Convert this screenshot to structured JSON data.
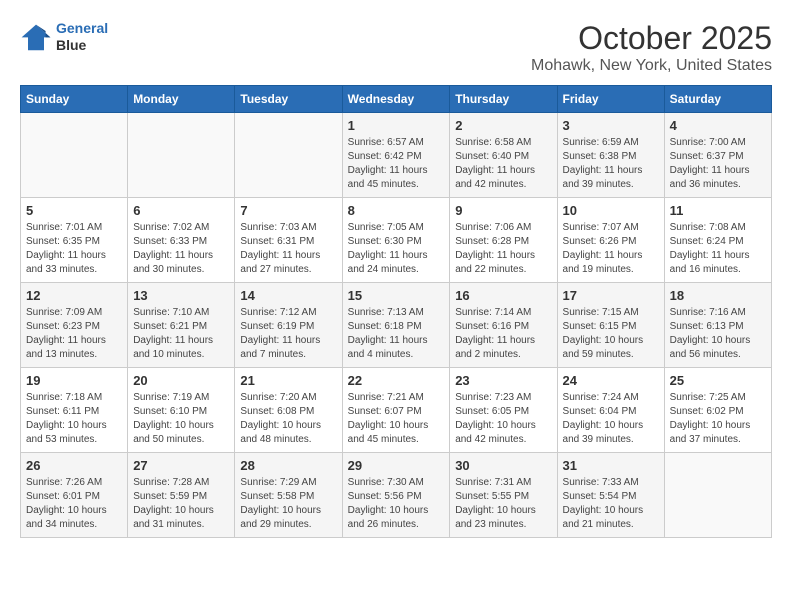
{
  "header": {
    "logo_line1": "General",
    "logo_line2": "Blue",
    "month": "October 2025",
    "location": "Mohawk, New York, United States"
  },
  "weekdays": [
    "Sunday",
    "Monday",
    "Tuesday",
    "Wednesday",
    "Thursday",
    "Friday",
    "Saturday"
  ],
  "weeks": [
    [
      {
        "day": "",
        "info": ""
      },
      {
        "day": "",
        "info": ""
      },
      {
        "day": "",
        "info": ""
      },
      {
        "day": "1",
        "info": "Sunrise: 6:57 AM\nSunset: 6:42 PM\nDaylight: 11 hours and 45 minutes."
      },
      {
        "day": "2",
        "info": "Sunrise: 6:58 AM\nSunset: 6:40 PM\nDaylight: 11 hours and 42 minutes."
      },
      {
        "day": "3",
        "info": "Sunrise: 6:59 AM\nSunset: 6:38 PM\nDaylight: 11 hours and 39 minutes."
      },
      {
        "day": "4",
        "info": "Sunrise: 7:00 AM\nSunset: 6:37 PM\nDaylight: 11 hours and 36 minutes."
      }
    ],
    [
      {
        "day": "5",
        "info": "Sunrise: 7:01 AM\nSunset: 6:35 PM\nDaylight: 11 hours and 33 minutes."
      },
      {
        "day": "6",
        "info": "Sunrise: 7:02 AM\nSunset: 6:33 PM\nDaylight: 11 hours and 30 minutes."
      },
      {
        "day": "7",
        "info": "Sunrise: 7:03 AM\nSunset: 6:31 PM\nDaylight: 11 hours and 27 minutes."
      },
      {
        "day": "8",
        "info": "Sunrise: 7:05 AM\nSunset: 6:30 PM\nDaylight: 11 hours and 24 minutes."
      },
      {
        "day": "9",
        "info": "Sunrise: 7:06 AM\nSunset: 6:28 PM\nDaylight: 11 hours and 22 minutes."
      },
      {
        "day": "10",
        "info": "Sunrise: 7:07 AM\nSunset: 6:26 PM\nDaylight: 11 hours and 19 minutes."
      },
      {
        "day": "11",
        "info": "Sunrise: 7:08 AM\nSunset: 6:24 PM\nDaylight: 11 hours and 16 minutes."
      }
    ],
    [
      {
        "day": "12",
        "info": "Sunrise: 7:09 AM\nSunset: 6:23 PM\nDaylight: 11 hours and 13 minutes."
      },
      {
        "day": "13",
        "info": "Sunrise: 7:10 AM\nSunset: 6:21 PM\nDaylight: 11 hours and 10 minutes."
      },
      {
        "day": "14",
        "info": "Sunrise: 7:12 AM\nSunset: 6:19 PM\nDaylight: 11 hours and 7 minutes."
      },
      {
        "day": "15",
        "info": "Sunrise: 7:13 AM\nSunset: 6:18 PM\nDaylight: 11 hours and 4 minutes."
      },
      {
        "day": "16",
        "info": "Sunrise: 7:14 AM\nSunset: 6:16 PM\nDaylight: 11 hours and 2 minutes."
      },
      {
        "day": "17",
        "info": "Sunrise: 7:15 AM\nSunset: 6:15 PM\nDaylight: 10 hours and 59 minutes."
      },
      {
        "day": "18",
        "info": "Sunrise: 7:16 AM\nSunset: 6:13 PM\nDaylight: 10 hours and 56 minutes."
      }
    ],
    [
      {
        "day": "19",
        "info": "Sunrise: 7:18 AM\nSunset: 6:11 PM\nDaylight: 10 hours and 53 minutes."
      },
      {
        "day": "20",
        "info": "Sunrise: 7:19 AM\nSunset: 6:10 PM\nDaylight: 10 hours and 50 minutes."
      },
      {
        "day": "21",
        "info": "Sunrise: 7:20 AM\nSunset: 6:08 PM\nDaylight: 10 hours and 48 minutes."
      },
      {
        "day": "22",
        "info": "Sunrise: 7:21 AM\nSunset: 6:07 PM\nDaylight: 10 hours and 45 minutes."
      },
      {
        "day": "23",
        "info": "Sunrise: 7:23 AM\nSunset: 6:05 PM\nDaylight: 10 hours and 42 minutes."
      },
      {
        "day": "24",
        "info": "Sunrise: 7:24 AM\nSunset: 6:04 PM\nDaylight: 10 hours and 39 minutes."
      },
      {
        "day": "25",
        "info": "Sunrise: 7:25 AM\nSunset: 6:02 PM\nDaylight: 10 hours and 37 minutes."
      }
    ],
    [
      {
        "day": "26",
        "info": "Sunrise: 7:26 AM\nSunset: 6:01 PM\nDaylight: 10 hours and 34 minutes."
      },
      {
        "day": "27",
        "info": "Sunrise: 7:28 AM\nSunset: 5:59 PM\nDaylight: 10 hours and 31 minutes."
      },
      {
        "day": "28",
        "info": "Sunrise: 7:29 AM\nSunset: 5:58 PM\nDaylight: 10 hours and 29 minutes."
      },
      {
        "day": "29",
        "info": "Sunrise: 7:30 AM\nSunset: 5:56 PM\nDaylight: 10 hours and 26 minutes."
      },
      {
        "day": "30",
        "info": "Sunrise: 7:31 AM\nSunset: 5:55 PM\nDaylight: 10 hours and 23 minutes."
      },
      {
        "day": "31",
        "info": "Sunrise: 7:33 AM\nSunset: 5:54 PM\nDaylight: 10 hours and 21 minutes."
      },
      {
        "day": "",
        "info": ""
      }
    ]
  ]
}
